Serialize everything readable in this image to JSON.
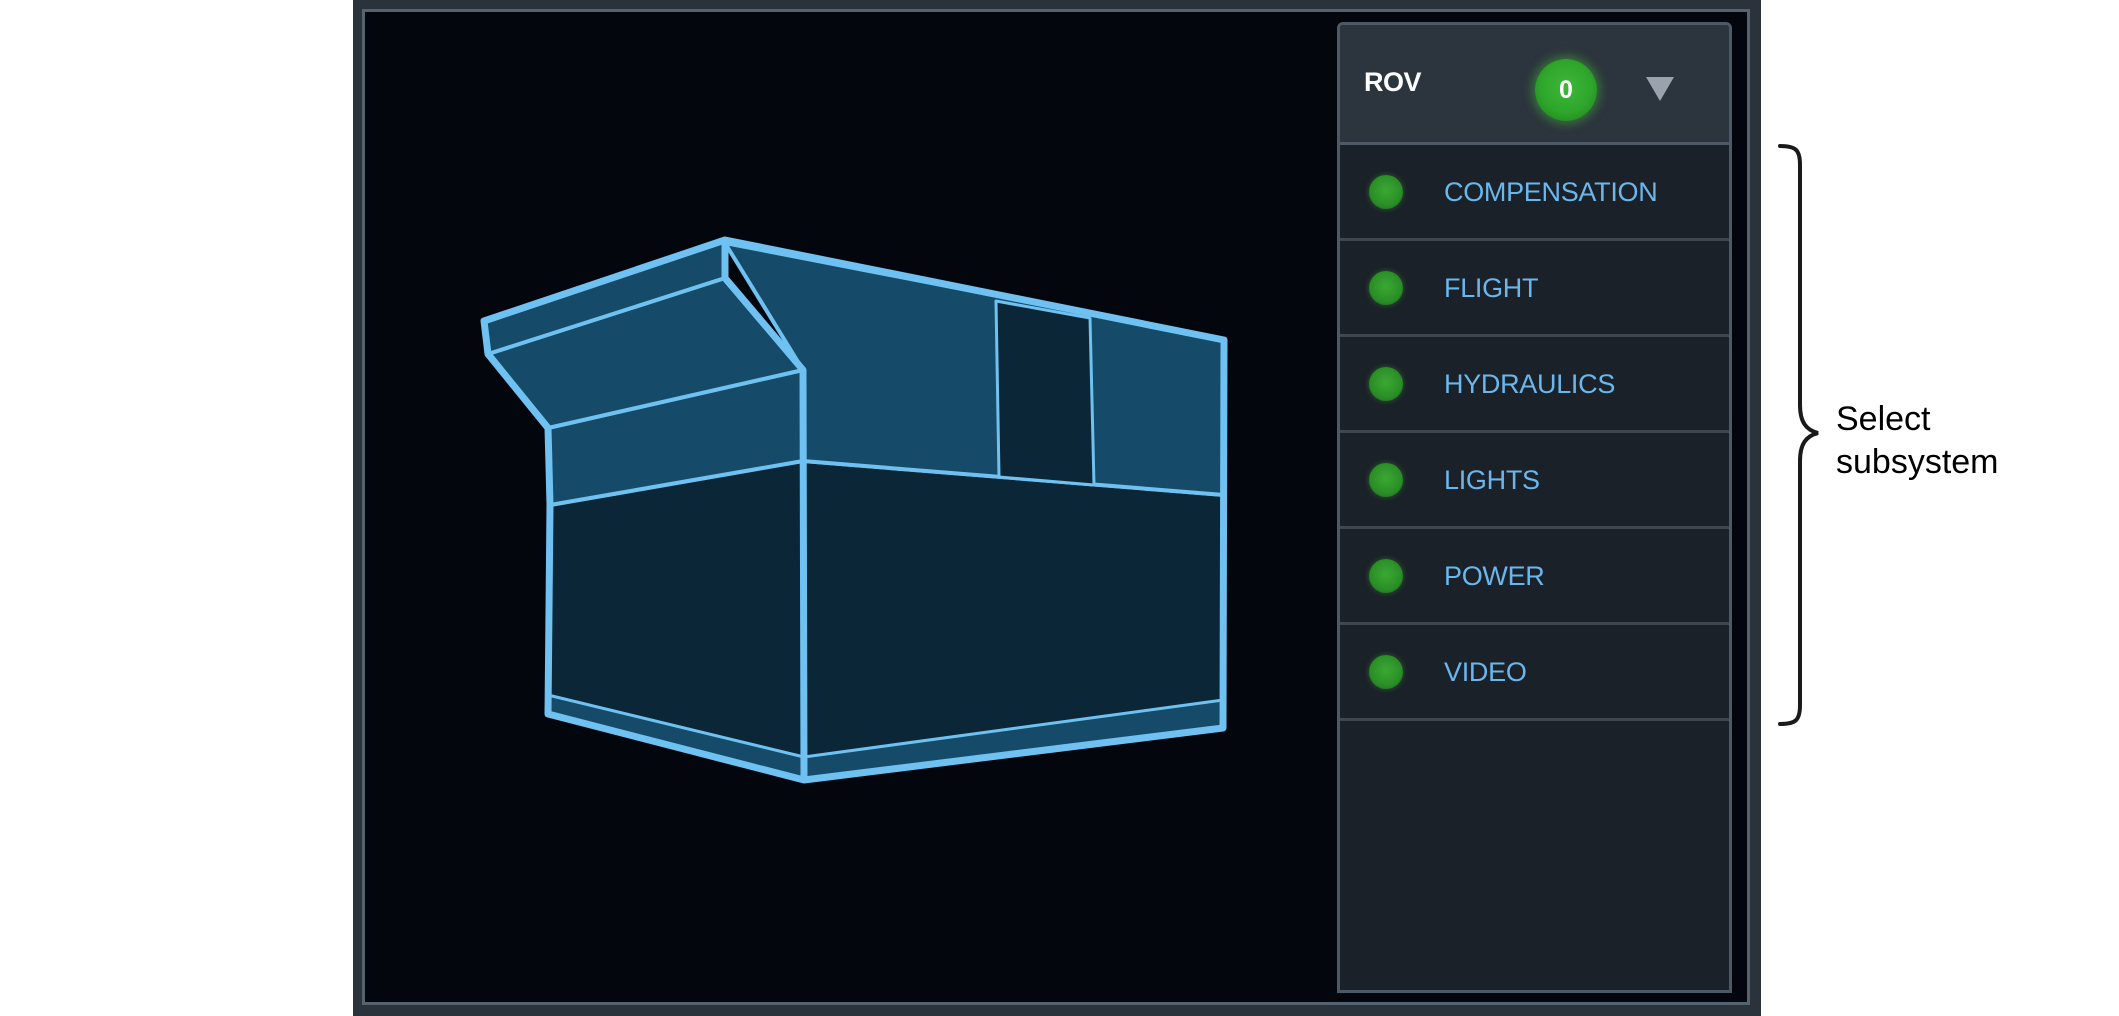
{
  "panel": {
    "title": "ROV",
    "badge_count": "0",
    "dropdown_icon": "triangle-down-icon"
  },
  "subsystems": [
    {
      "label": "COMPENSATION",
      "status": "ok"
    },
    {
      "label": "FLIGHT",
      "status": "ok"
    },
    {
      "label": "HYDRAULICS",
      "status": "ok"
    },
    {
      "label": "LIGHTS",
      "status": "ok"
    },
    {
      "label": "POWER",
      "status": "ok"
    },
    {
      "label": "VIDEO",
      "status": "ok"
    }
  ],
  "annotation": {
    "text": "Select\nsubsystem"
  },
  "colors": {
    "accent_blue": "#6bb7ec",
    "status_green": "#2ea62b",
    "model_outline": "#6ec1f0",
    "model_fill_light": "#154a68",
    "model_fill_dark": "#0a2637"
  }
}
